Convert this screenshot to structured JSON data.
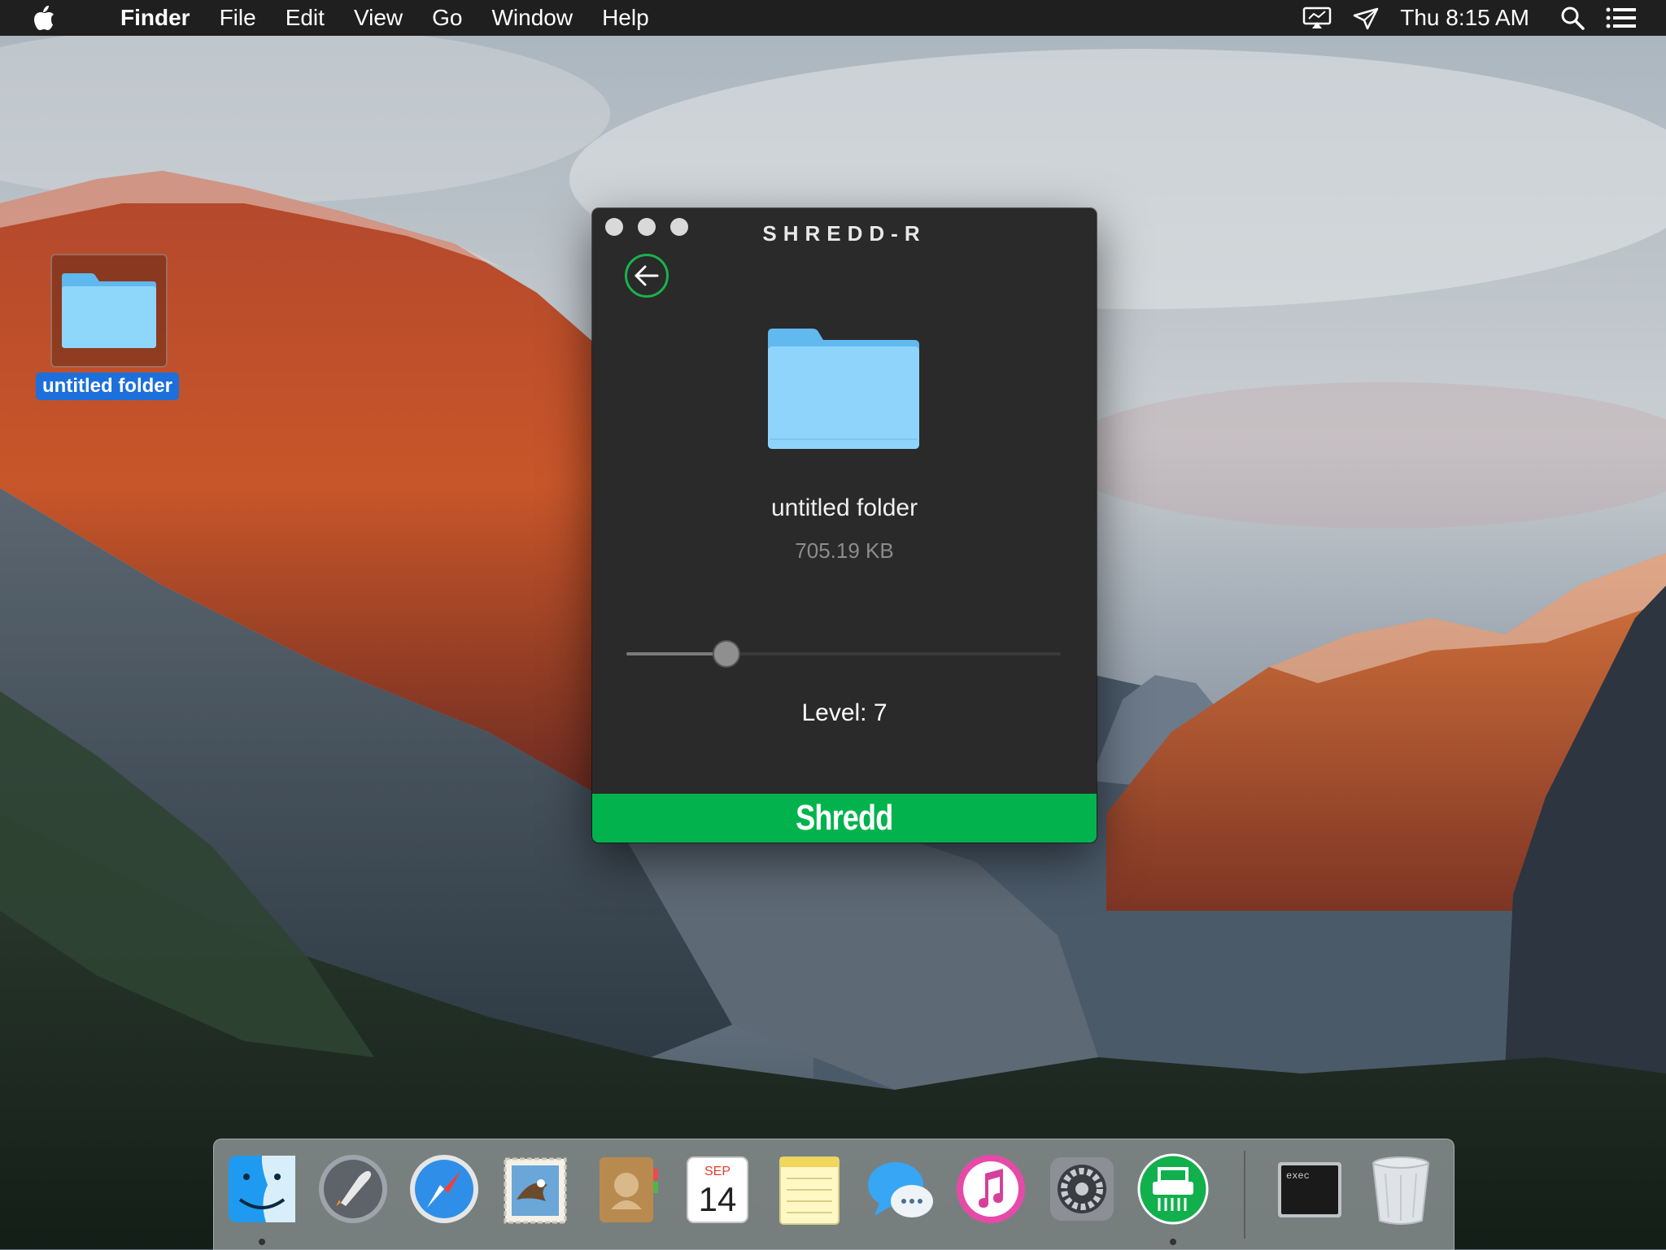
{
  "menubar": {
    "app_name": "Finder",
    "menus": [
      "File",
      "Edit",
      "View",
      "Go",
      "Window",
      "Help"
    ],
    "clock": "Thu 8:15 AM",
    "status_icons": [
      "display-mirroring-icon",
      "airplay-send-icon",
      "spotlight-search-icon",
      "notification-center-icon"
    ]
  },
  "desktop": {
    "folder_label": "untitled folder"
  },
  "app": {
    "title": "SHREDD-R",
    "file_name": "untitled folder",
    "file_size": "705.19 KB",
    "level_text": "Level: 7",
    "level_value": 7,
    "slider_fraction": 0.23,
    "shred_label": "Shredd",
    "accent_color": "#02b34d"
  },
  "dock": {
    "items": [
      "finder-icon",
      "launchpad-icon",
      "safari-icon",
      "mail-icon",
      "contacts-icon",
      "calendar-icon",
      "notes-icon",
      "messages-icon",
      "itunes-icon",
      "system-preferences-icon",
      "shredd-r-icon",
      "terminal-icon",
      "trash-icon"
    ],
    "calendar_month": "SEP",
    "calendar_day": "14",
    "terminal_text": "exec"
  }
}
